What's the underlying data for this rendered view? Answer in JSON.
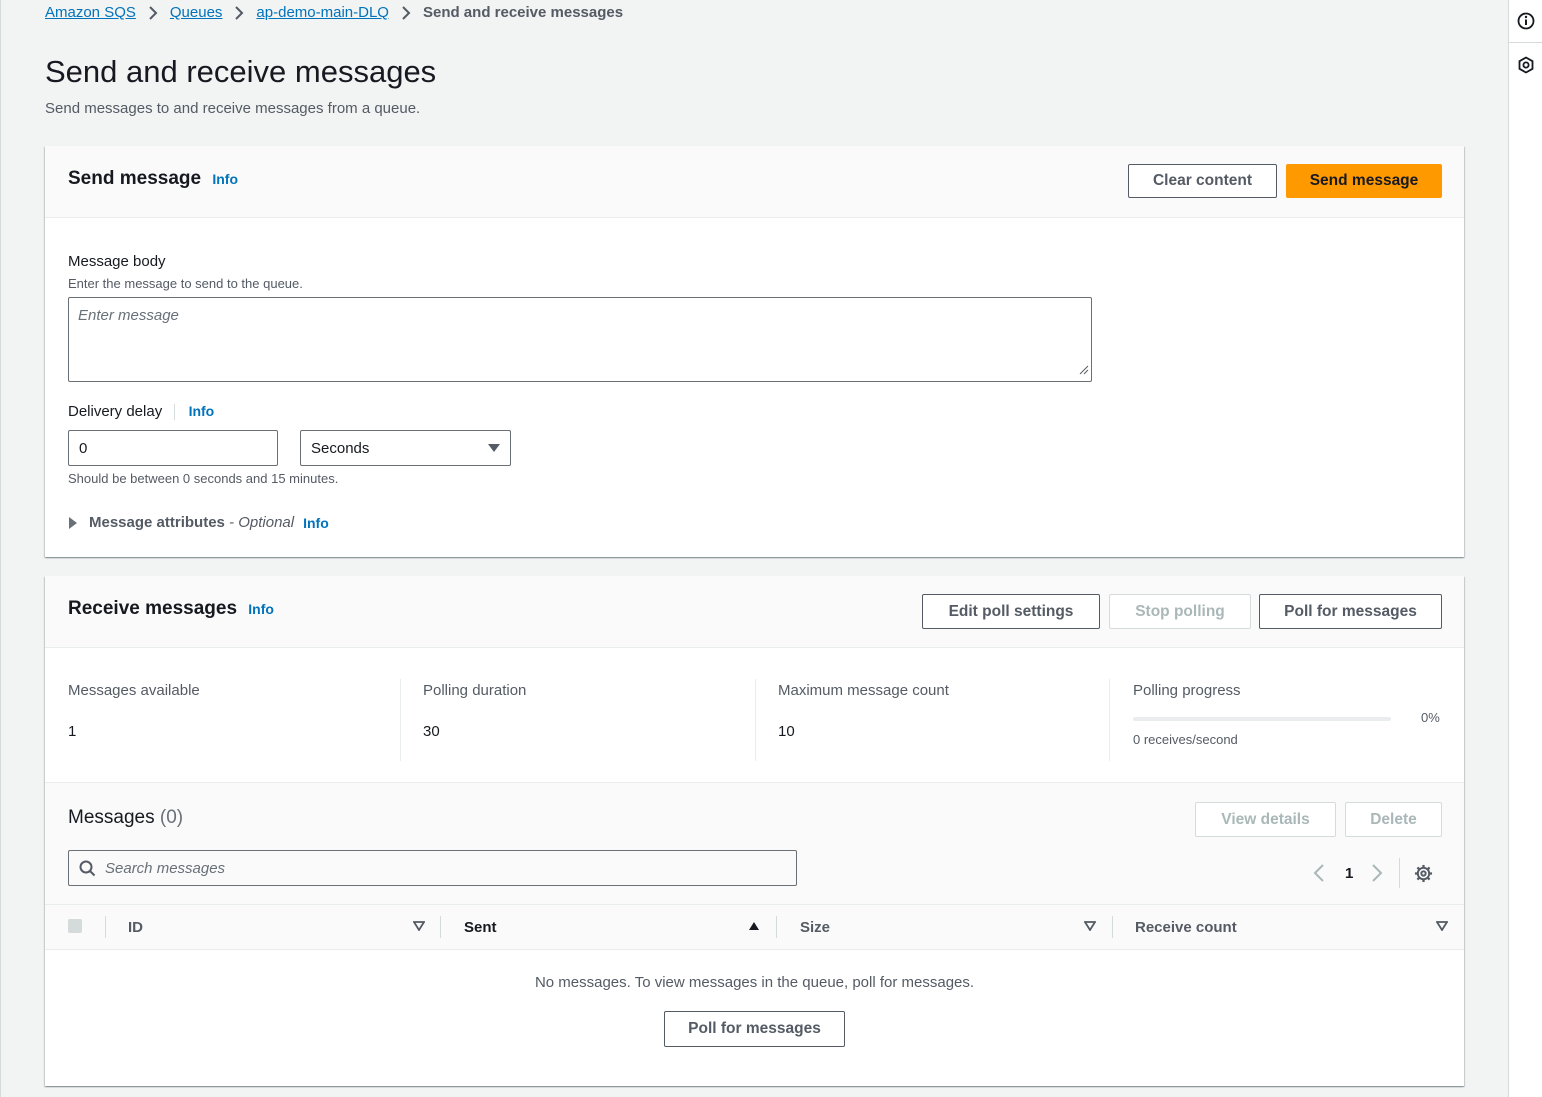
{
  "breadcrumb": {
    "items": [
      "Amazon SQS",
      "Queues",
      "ap-demo-main-DLQ"
    ],
    "current": "Send and receive messages"
  },
  "page": {
    "title": "Send and receive messages",
    "description": "Send messages to and receive messages from a queue."
  },
  "send_panel": {
    "title": "Send message",
    "info": "Info",
    "clear_button": "Clear content",
    "send_button": "Send message",
    "body_label": "Message body",
    "body_hint": "Enter the message to send to the queue.",
    "body_placeholder": "Enter message",
    "delay_label": "Delivery delay",
    "delay_info": "Info",
    "delay_value": "0",
    "delay_unit": "Seconds",
    "delay_hint": "Should be between 0 seconds and 15 minutes.",
    "attributes_label": "Message attributes",
    "attributes_optional": " - Optional",
    "attributes_info": "Info"
  },
  "receive_panel": {
    "title": "Receive messages",
    "info": "Info",
    "edit_button": "Edit poll settings",
    "stop_button": "Stop polling",
    "poll_button": "Poll for messages",
    "stats": {
      "available_label": "Messages available",
      "available_value": "1",
      "duration_label": "Polling duration",
      "duration_value": "30",
      "max_label": "Maximum message count",
      "max_value": "10",
      "progress_label": "Polling progress",
      "progress_percent": "0%",
      "progress_fraction": 0,
      "rate": "0 receives/second"
    },
    "messages": {
      "title": "Messages",
      "count": "(0)",
      "view_details_button": "View details",
      "delete_button": "Delete",
      "search_placeholder": "Search messages",
      "page_number": "1",
      "columns": [
        "ID",
        "Sent",
        "Size",
        "Receive count"
      ],
      "empty_text": "No messages. To view messages in the queue, poll for messages.",
      "empty_poll_button": "Poll for messages"
    }
  },
  "colors": {
    "link": "#0073bb",
    "primary_button": "#ff9900",
    "background": "#f2f3f3"
  },
  "icons": [
    "info-icon",
    "feedback-icon",
    "chevron-right-icon",
    "caret-down-icon",
    "caret-right-icon",
    "search-icon",
    "chevron-left-icon",
    "gear-icon",
    "sort-down-icon",
    "sort-up-icon",
    "resize-handle-icon"
  ]
}
